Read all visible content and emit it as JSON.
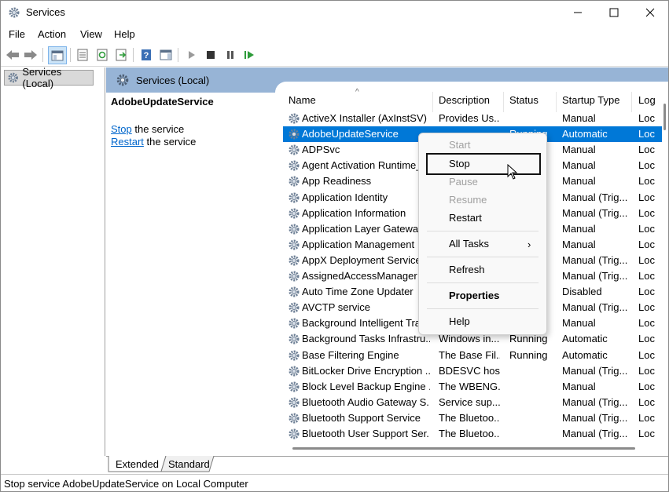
{
  "window": {
    "title": "Services"
  },
  "menu": [
    "File",
    "Action",
    "View",
    "Help"
  ],
  "tree": {
    "root_label": "Services (Local)"
  },
  "panel": {
    "title": "Services (Local)",
    "selected_service": "AdobeUpdateService",
    "stop_link": "Stop",
    "stop_suffix": " the service",
    "restart_link": "Restart",
    "restart_suffix": " the service"
  },
  "columns": [
    "Name",
    "Description",
    "Status",
    "Startup Type",
    "Log"
  ],
  "rows": [
    {
      "name": "ActiveX Installer (AxInstSV)",
      "desc": "Provides Us...",
      "status": "",
      "startup": "Manual",
      "log": "Loc"
    },
    {
      "name": "AdobeUpdateService",
      "desc": "",
      "status": "Running",
      "startup": "Automatic",
      "log": "Loc",
      "selected": true
    },
    {
      "name": "ADPSvc",
      "desc": "",
      "status": "",
      "startup": "Manual",
      "log": "Loc"
    },
    {
      "name": "Agent Activation Runtime_",
      "desc": "",
      "status": "",
      "startup": "Manual",
      "log": "Loc"
    },
    {
      "name": "App Readiness",
      "desc": "",
      "status": "",
      "startup": "Manual",
      "log": "Loc"
    },
    {
      "name": "Application Identity",
      "desc": "",
      "status": "",
      "startup": "Manual (Trig...",
      "log": "Loc"
    },
    {
      "name": "Application Information",
      "desc": "",
      "status": "",
      "startup": "Manual (Trig...",
      "log": "Loc"
    },
    {
      "name": "Application Layer Gateway",
      "desc": "",
      "status": "",
      "startup": "Manual",
      "log": "Loc"
    },
    {
      "name": "Application Management",
      "desc": "",
      "status": "",
      "startup": "Manual",
      "log": "Loc"
    },
    {
      "name": "AppX Deployment Service",
      "desc": "",
      "status": "",
      "startup": "Manual (Trig...",
      "log": "Loc"
    },
    {
      "name": "AssignedAccessManager S",
      "desc": "",
      "status": "",
      "startup": "Manual (Trig...",
      "log": "Loc"
    },
    {
      "name": "Auto Time Zone Updater",
      "desc": "",
      "status": "",
      "startup": "Disabled",
      "log": "Loc"
    },
    {
      "name": "AVCTP service",
      "desc": "",
      "status": "",
      "startup": "Manual (Trig...",
      "log": "Loc"
    },
    {
      "name": "Background Intelligent Tra",
      "desc": "",
      "status": "",
      "startup": "Manual",
      "log": "Loc"
    },
    {
      "name": "Background Tasks Infrastru...",
      "desc": "Windows in...",
      "status": "Running",
      "startup": "Automatic",
      "log": "Loc"
    },
    {
      "name": "Base Filtering Engine",
      "desc": "The Base Fil...",
      "status": "Running",
      "startup": "Automatic",
      "log": "Loc"
    },
    {
      "name": "BitLocker Drive Encryption ...",
      "desc": "BDESVC hos...",
      "status": "",
      "startup": "Manual (Trig...",
      "log": "Loc"
    },
    {
      "name": "Block Level Backup Engine ...",
      "desc": "The WBENG...",
      "status": "",
      "startup": "Manual",
      "log": "Loc"
    },
    {
      "name": "Bluetooth Audio Gateway S...",
      "desc": "Service sup...",
      "status": "",
      "startup": "Manual (Trig...",
      "log": "Loc"
    },
    {
      "name": "Bluetooth Support Service",
      "desc": "The Bluetoo...",
      "status": "",
      "startup": "Manual (Trig...",
      "log": "Loc"
    },
    {
      "name": "Bluetooth User Support Ser...",
      "desc": "The Bluetoo...",
      "status": "",
      "startup": "Manual (Trig...",
      "log": "Loc"
    }
  ],
  "tabs": [
    "Extended",
    "Standard"
  ],
  "status_bar": "Stop service AdobeUpdateService on Local Computer",
  "context_menu": {
    "start": "Start",
    "stop": "Stop",
    "pause": "Pause",
    "resume": "Resume",
    "restart": "Restart",
    "all_tasks": "All Tasks",
    "refresh": "Refresh",
    "properties": "Properties",
    "help": "Help"
  },
  "colors": {
    "selection": "#0078d7",
    "header_band": "#97b4d6",
    "link": "#0066cc"
  }
}
